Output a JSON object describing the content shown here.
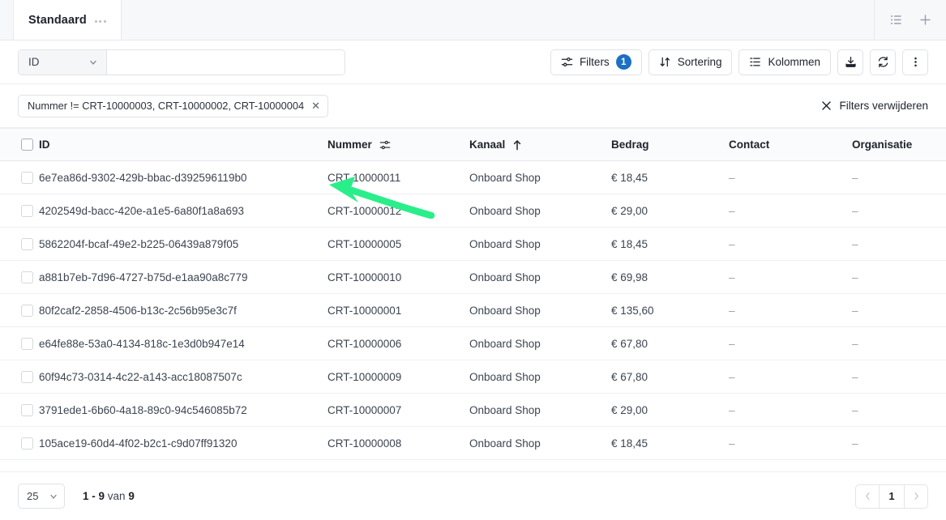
{
  "tabbar": {
    "active_tab": "Standaard",
    "tab_menu_icon": "ellipsis-icon",
    "list_view_icon": "list-view-icon",
    "add_icon": "plus-icon"
  },
  "search": {
    "field_label": "ID",
    "chevron_icon": "chevron-down-icon",
    "value": "",
    "placeholder": ""
  },
  "toolbar": {
    "filters_label": "Filters",
    "filters_count": "1",
    "filters_icon": "filter-sliders-icon",
    "sort_label": "Sortering",
    "sort_icon": "sort-arrows-icon",
    "columns_label": "Kolommen",
    "columns_icon": "columns-icon",
    "download_icon": "download-icon",
    "refresh_icon": "refresh-icon",
    "more_icon": "kebab-menu-icon",
    "accent_badge_color": "#1b6fc4"
  },
  "filters": {
    "chip_label": "Nummer != CRT-10000003, CRT-10000002, CRT-10000004",
    "chip_remove_icon": "close-icon",
    "clear_label": "Filters verwijderen",
    "clear_icon": "close-icon"
  },
  "annotation": {
    "arrow_color": "#2aee8a",
    "arrow_icon": "curved-left-arrow"
  },
  "table": {
    "columns": [
      {
        "key": "id",
        "label": "ID",
        "icon": ""
      },
      {
        "key": "nummer",
        "label": "Nummer",
        "icon": "filter-sliders-icon"
      },
      {
        "key": "kanaal",
        "label": "Kanaal",
        "icon": "sort-asc-arrow-icon"
      },
      {
        "key": "bedrag",
        "label": "Bedrag",
        "icon": ""
      },
      {
        "key": "contact",
        "label": "Contact",
        "icon": ""
      },
      {
        "key": "organisatie",
        "label": "Organisatie",
        "icon": ""
      }
    ],
    "rows": [
      {
        "id": "6e7ea86d-9302-429b-bbac-d392596119b0",
        "nummer": "CRT-10000011",
        "kanaal": "Onboard Shop",
        "bedrag": "€ 18,45",
        "contact": "–",
        "organisatie": "–"
      },
      {
        "id": "4202549d-bacc-420e-a1e5-6a80f1a8a693",
        "nummer": "CRT-10000012",
        "kanaal": "Onboard Shop",
        "bedrag": "€ 29,00",
        "contact": "–",
        "organisatie": "–"
      },
      {
        "id": "5862204f-bcaf-49e2-b225-06439a879f05",
        "nummer": "CRT-10000005",
        "kanaal": "Onboard Shop",
        "bedrag": "€ 18,45",
        "contact": "–",
        "organisatie": "–"
      },
      {
        "id": "a881b7eb-7d96-4727-b75d-e1aa90a8c779",
        "nummer": "CRT-10000010",
        "kanaal": "Onboard Shop",
        "bedrag": "€ 69,98",
        "contact": "–",
        "organisatie": "–"
      },
      {
        "id": "80f2caf2-2858-4506-b13c-2c56b95e3c7f",
        "nummer": "CRT-10000001",
        "kanaal": "Onboard Shop",
        "bedrag": "€ 135,60",
        "contact": "–",
        "organisatie": "–"
      },
      {
        "id": "e64fe88e-53a0-4134-818c-1e3d0b947e14",
        "nummer": "CRT-10000006",
        "kanaal": "Onboard Shop",
        "bedrag": "€ 67,80",
        "contact": "–",
        "organisatie": "–"
      },
      {
        "id": "60f94c73-0314-4c22-a143-acc18087507c",
        "nummer": "CRT-10000009",
        "kanaal": "Onboard Shop",
        "bedrag": "€ 67,80",
        "contact": "–",
        "organisatie": "–"
      },
      {
        "id": "3791ede1-6b60-4a18-89c0-94c546085b72",
        "nummer": "CRT-10000007",
        "kanaal": "Onboard Shop",
        "bedrag": "€ 29,00",
        "contact": "–",
        "organisatie": "–"
      },
      {
        "id": "105ace19-60d4-4f02-b2c1-c9d07ff91320",
        "nummer": "CRT-10000008",
        "kanaal": "Onboard Shop",
        "bedrag": "€ 18,45",
        "contact": "–",
        "organisatie": "–"
      }
    ]
  },
  "footer": {
    "page_size": "25",
    "page_size_chevron": "chevron-down-icon",
    "range_prefix": "1 - ",
    "range_current": "9",
    "range_middle": " van ",
    "range_total": "9",
    "prev_icon": "chevron-left-icon",
    "current_page": "1",
    "next_icon": "chevron-right-icon"
  }
}
